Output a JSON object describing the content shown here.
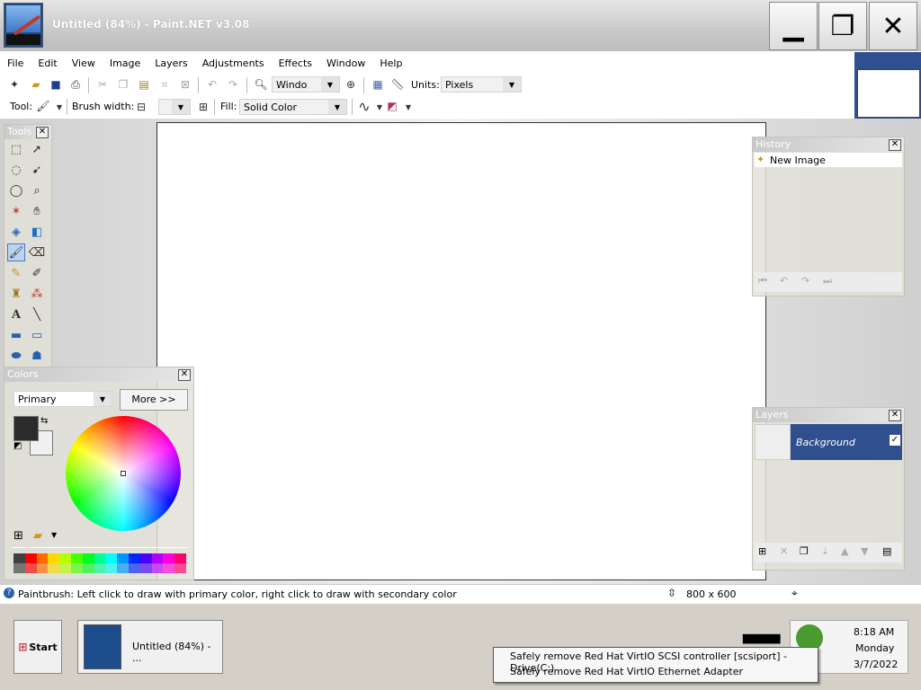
{
  "window": {
    "title": "Untitled (84%) - Paint.NET v3.08"
  },
  "window_buttons": {
    "minimize": "▁",
    "maximize": "❐",
    "close": "✕"
  },
  "menu": [
    "File",
    "Edit",
    "View",
    "Image",
    "Layers",
    "Adjustments",
    "Effects",
    "Window",
    "Help"
  ],
  "toolbar1": {
    "zoom_value": "Windo",
    "units_label": "Units:",
    "units_value": "Pixels"
  },
  "toolbar2": {
    "tool_label": "Tool:",
    "brush_width_label": "Brush width:",
    "fill_label": "Fill:",
    "fill_value": "Solid Color"
  },
  "tools_panel": {
    "title": "Tools"
  },
  "colors_panel": {
    "title": "Colors",
    "primary_select": "Primary",
    "more_button": "More >>",
    "primary_color": "#2b2b2b",
    "secondary_color": "#f0f0f0"
  },
  "history_panel": {
    "title": "History",
    "items": [
      "New Image"
    ]
  },
  "layers_panel": {
    "title": "Layers",
    "layers": [
      {
        "name": "Background",
        "visible": true
      }
    ]
  },
  "statusbar": {
    "hint": "Paintbrush: Left click to draw with primary color, right click to draw with secondary color",
    "size": "800 x 600"
  },
  "taskbar": {
    "start_label": "Start",
    "task_label": "Untitled (84%) - ...",
    "time": "8:18 AM",
    "day": "Monday",
    "date": "3/7/2022"
  },
  "tray_menu": [
    "Safely remove Red Hat VirtIO SCSI controller [scsiport] - Drive(C:)",
    "Safely remove Red Hat VirtIO Ethernet Adapter"
  ],
  "palette": [
    "#404040",
    "#ff0000",
    "#ff6a00",
    "#ffd800",
    "#b6ff00",
    "#4cff00",
    "#00ff21",
    "#00ff90",
    "#00ffff",
    "#0094ff",
    "#0026ff",
    "#4800ff",
    "#b200ff",
    "#ff00dc",
    "#ff006e"
  ]
}
